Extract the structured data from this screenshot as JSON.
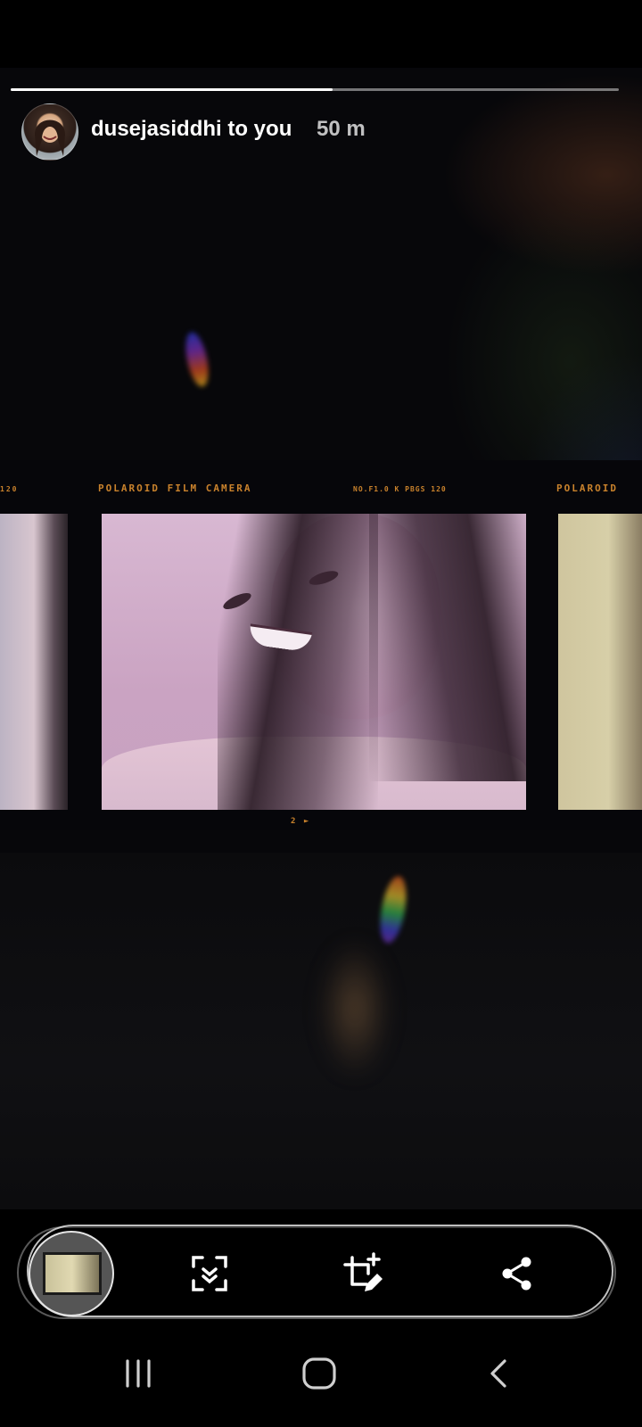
{
  "story": {
    "username": "dusejasiddhi to you",
    "time": "50 m",
    "progress": 0.53,
    "film": {
      "top_left_label": "POLAROID  FILM CAMERA",
      "top_mid_label": "NO.F1.0  K  PBGS 120",
      "top_right_label": "POLAROID",
      "left_edge_label": "120",
      "bottom_label": "2 ►"
    }
  },
  "toolbar": {
    "items": [
      {
        "name": "story-thumbnail"
      },
      {
        "name": "scan-icon"
      },
      {
        "name": "crop-edit-icon"
      },
      {
        "name": "share-icon"
      }
    ]
  },
  "navigation": {
    "buttons": [
      "recent-apps-icon",
      "home-icon",
      "back-icon"
    ]
  }
}
